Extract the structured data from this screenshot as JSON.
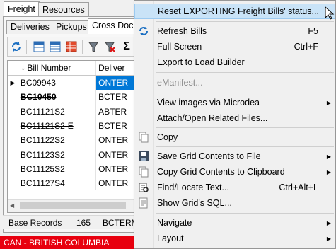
{
  "window": {
    "outer_tabs": [
      "Freight",
      "Resources"
    ],
    "inner_tabs": [
      "Deliveries",
      "Pickups",
      "Cross Dock"
    ]
  },
  "grid": {
    "col_bill": "Bill Number",
    "col_deliver": "Deliver",
    "rows": [
      {
        "bill": "BC09943",
        "deliver": "ONTER",
        "style": "current"
      },
      {
        "bill": "BC10450",
        "deliver": "BCTER",
        "style": "bold-strike"
      },
      {
        "bill": "BC11121S2",
        "deliver": "ABTER",
        "style": ""
      },
      {
        "bill": "BC11121S2-E",
        "deliver": "BCTER",
        "style": "strike"
      },
      {
        "bill": "BC11122S2",
        "deliver": "ONTER",
        "style": ""
      },
      {
        "bill": "BC11123S2",
        "deliver": "ONTER",
        "style": ""
      },
      {
        "bill": "BC11125S2",
        "deliver": "ONTER",
        "style": ""
      },
      {
        "bill": "BC11127S4",
        "deliver": "ONTER",
        "style": ""
      }
    ]
  },
  "status": {
    "label": "Base Records",
    "count": "165",
    "extra": "BCTERM"
  },
  "bottom_bar": {
    "text": "CAN - BRITISH COLUMBIA",
    "color": "#e8000f"
  },
  "menu": {
    "reset": "Reset EXPORTING Freight Bills' status...",
    "refresh": "Refresh Bills",
    "refresh_sc": "F5",
    "fullscreen": "Full Screen",
    "fullscreen_sc": "Ctrl+F",
    "export": "Export to Load Builder",
    "emanifest": "eManifest...",
    "view_images": "View images via Microdea",
    "attach": "Attach/Open Related Files...",
    "copy": "Copy",
    "save_grid": "Save Grid Contents to File",
    "copy_grid": "Copy Grid Contents to Clipboard",
    "find": "Find/Locate Text...",
    "find_sc": "Ctrl+Alt+L",
    "show_sql": "Show Grid's SQL...",
    "navigate": "Navigate",
    "layout": "Layout"
  }
}
